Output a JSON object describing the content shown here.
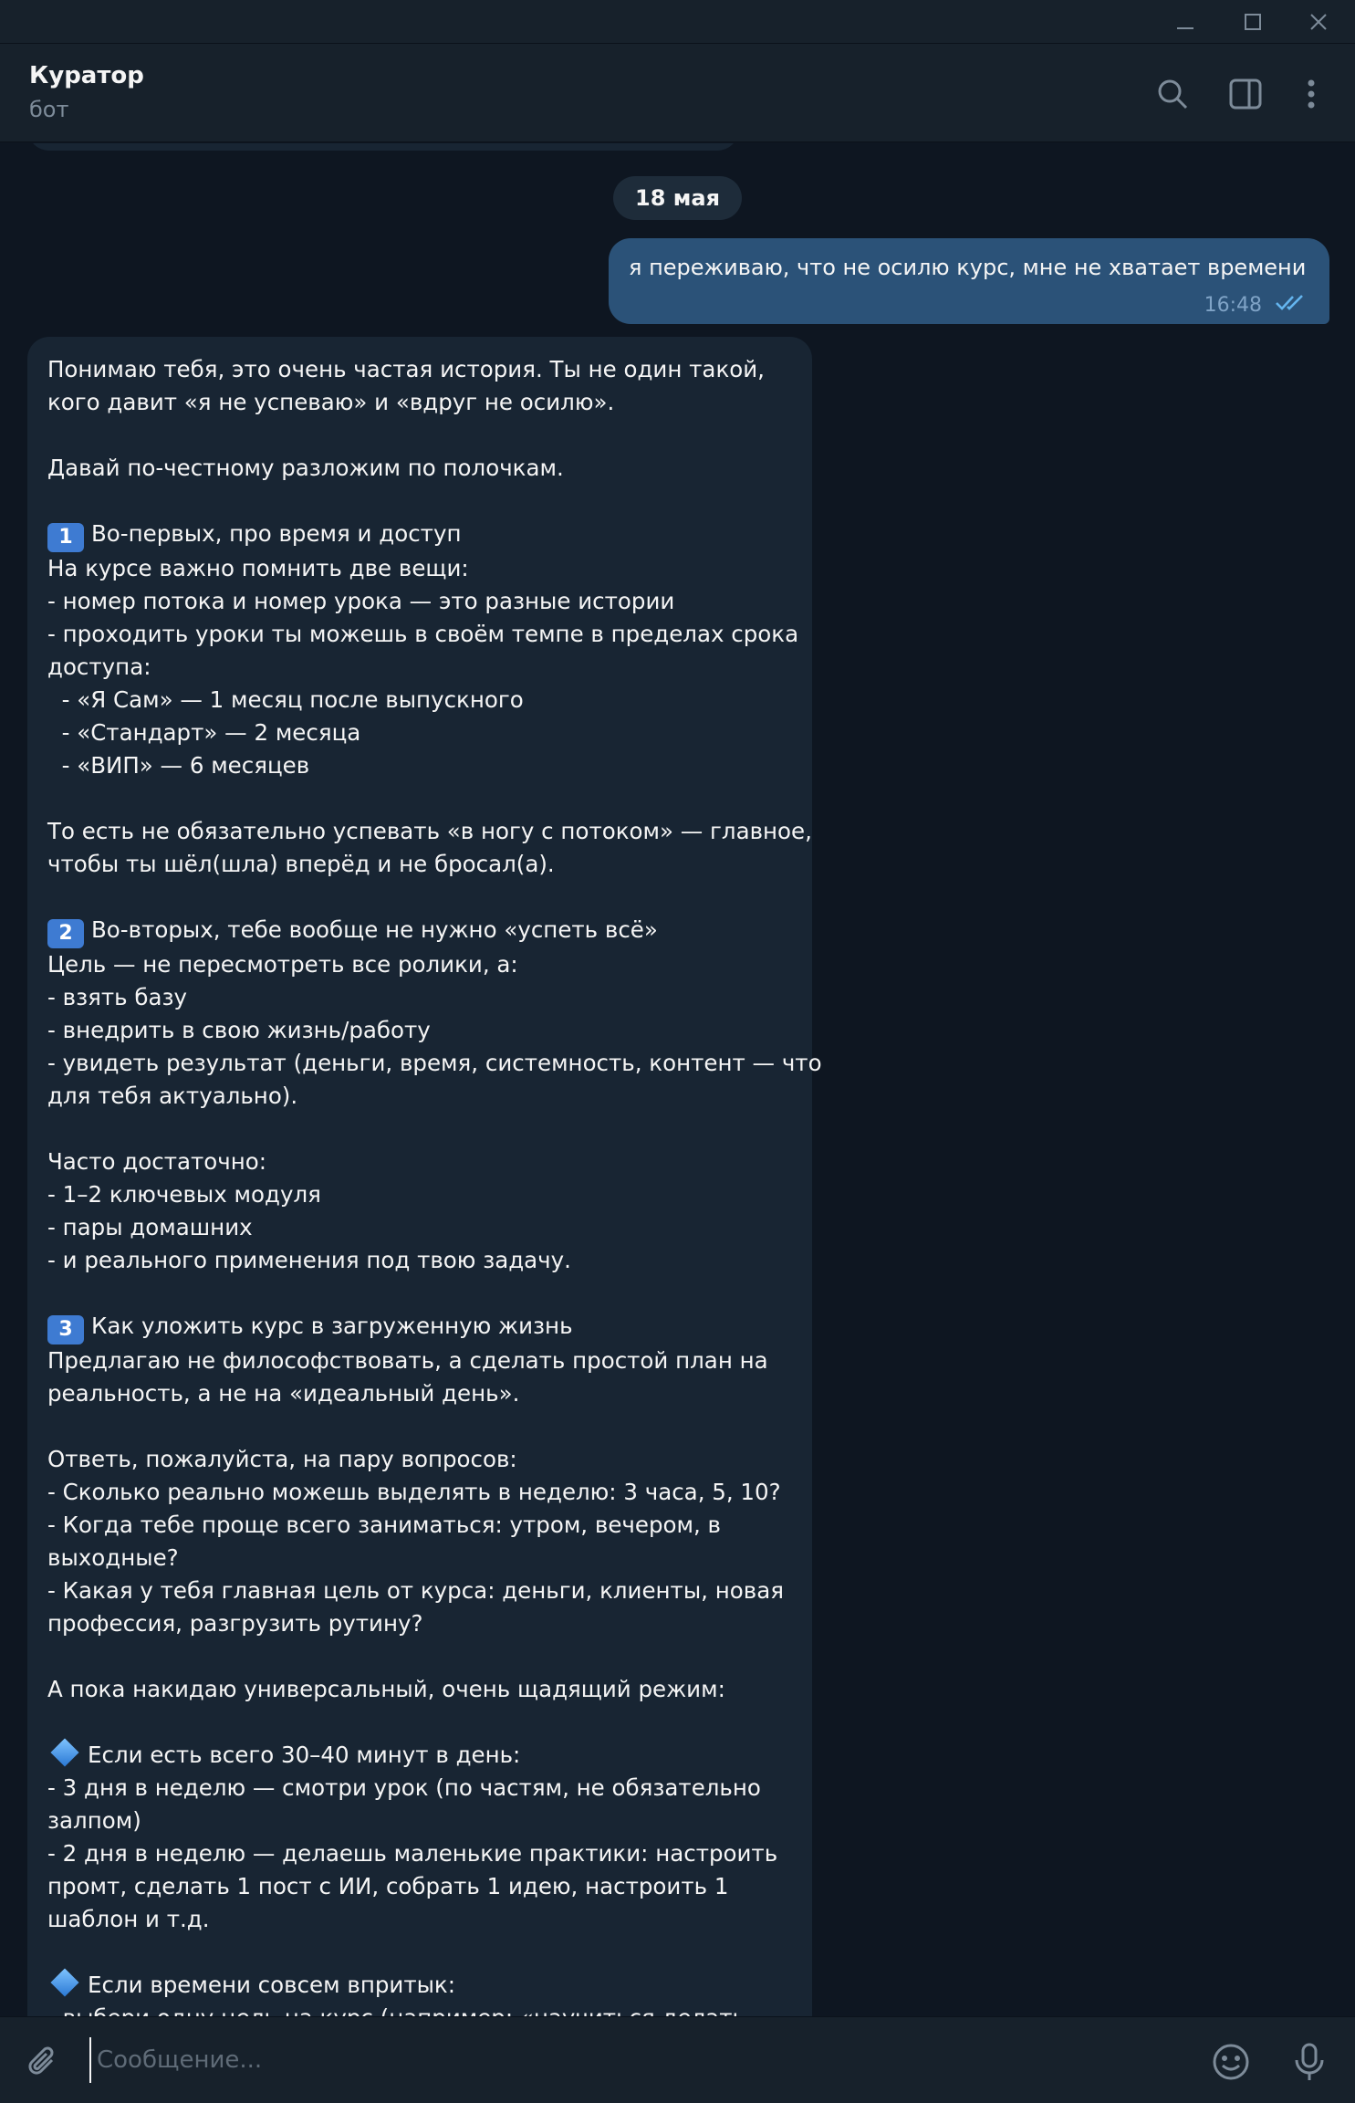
{
  "chat": {
    "title": "Куратор",
    "subtitle": "бот"
  },
  "date_separator": "18 мая",
  "outgoing": {
    "text": "я переживаю, что не осилю курс, мне не хватает времени",
    "time": "16:48",
    "status": "read"
  },
  "incoming": {
    "lines": [
      {
        "text": "Понимаю тебя, это очень частая история. Ты не один такой,"
      },
      {
        "text": "кого давит «я не успеваю» и «вдруг не осилю»."
      },
      {
        "text": ""
      },
      {
        "text": "Давай по-честному разложим по полочкам."
      },
      {
        "text": ""
      },
      {
        "badge": "1",
        "text": "Во-первых, про время и доступ"
      },
      {
        "text": "На курсе важно помнить две вещи:"
      },
      {
        "text": "- номер потока и номер урока — это разные истории"
      },
      {
        "text": "- проходить уроки ты можешь в своём темпе в пределах срока"
      },
      {
        "text": "доступа:"
      },
      {
        "text": "  - «Я Сам» — 1 месяц после выпускного"
      },
      {
        "text": "  - «Стандарт» — 2 месяца"
      },
      {
        "text": "  - «ВИП» — 6 месяцев"
      },
      {
        "text": ""
      },
      {
        "text": "То есть не обязательно успевать «в ногу с потоком» — главное,"
      },
      {
        "text": "чтобы ты шёл(шла) вперёд и не бросал(а)."
      },
      {
        "text": ""
      },
      {
        "badge": "2",
        "text": "Во-вторых, тебе вообще не нужно «успеть всё»"
      },
      {
        "text": "Цель — не пересмотреть все ролики, а:"
      },
      {
        "text": "- взять базу"
      },
      {
        "text": "- внедрить в свою жизнь/работу"
      },
      {
        "text": "- увидеть результат (деньги, время, системность, контент — что"
      },
      {
        "text": "для тебя актуально)."
      },
      {
        "text": ""
      },
      {
        "text": "Часто достаточно:"
      },
      {
        "text": "- 1–2 ключевых модуля"
      },
      {
        "text": "- пары домашних"
      },
      {
        "text": "- и реального применения под твою задачу."
      },
      {
        "text": ""
      },
      {
        "badge": "3",
        "text": "Как уложить курс в загруженную жизнь"
      },
      {
        "text": "Предлагаю не философствовать, а сделать простой план на"
      },
      {
        "text": "реальность, а не на «идеальный день»."
      },
      {
        "text": ""
      },
      {
        "text": "Ответь, пожалуйста, на пару вопросов:"
      },
      {
        "text": "- Сколько реально можешь выделять в неделю: 3 часа, 5, 10?"
      },
      {
        "text": "- Когда тебе проще всего заниматься: утром, вечером, в"
      },
      {
        "text": "выходные?"
      },
      {
        "text": "- Какая у тебя главная цель от курса: деньги, клиенты, новая"
      },
      {
        "text": "профессия, разгрузить рутину?"
      },
      {
        "text": ""
      },
      {
        "text": "А пока накидаю универсальный, очень щадящий режим:"
      },
      {
        "text": ""
      },
      {
        "diamond": true,
        "text": "Если есть всего 30–40 минут в день:"
      },
      {
        "text": "- 3 дня в неделю — смотри урок (по частям, не обязательно"
      },
      {
        "text": "залпом)"
      },
      {
        "text": "- 2 дня в неделю — делаешь маленькие практики: настроить"
      },
      {
        "text": "промт, сделать 1 пост с ИИ, собрать 1 идею, настроить 1"
      },
      {
        "text": "шаблон и т.д."
      },
      {
        "text": ""
      },
      {
        "diamond": true,
        "text": "Если времени совсем впритык:"
      },
      {
        "text": "- выбери одну цель на курс (например: «научиться делать"
      }
    ]
  },
  "composer": {
    "placeholder": "Сообщение..."
  },
  "icons": {
    "minimize": "minimize-icon",
    "maximize": "maximize-icon",
    "close": "close-icon",
    "search": "search-icon",
    "sidebar": "sidebar-toggle-icon",
    "menu": "more-vertical-icon",
    "attach": "paperclip-icon",
    "emoji": "emoji-icon",
    "voice": "microphone-icon"
  },
  "colors": {
    "background": "#0e1621",
    "header": "#17212b",
    "incoming_bubble": "#182533",
    "outgoing_bubble": "#2b5278",
    "read_checks": "#64b5ef"
  }
}
